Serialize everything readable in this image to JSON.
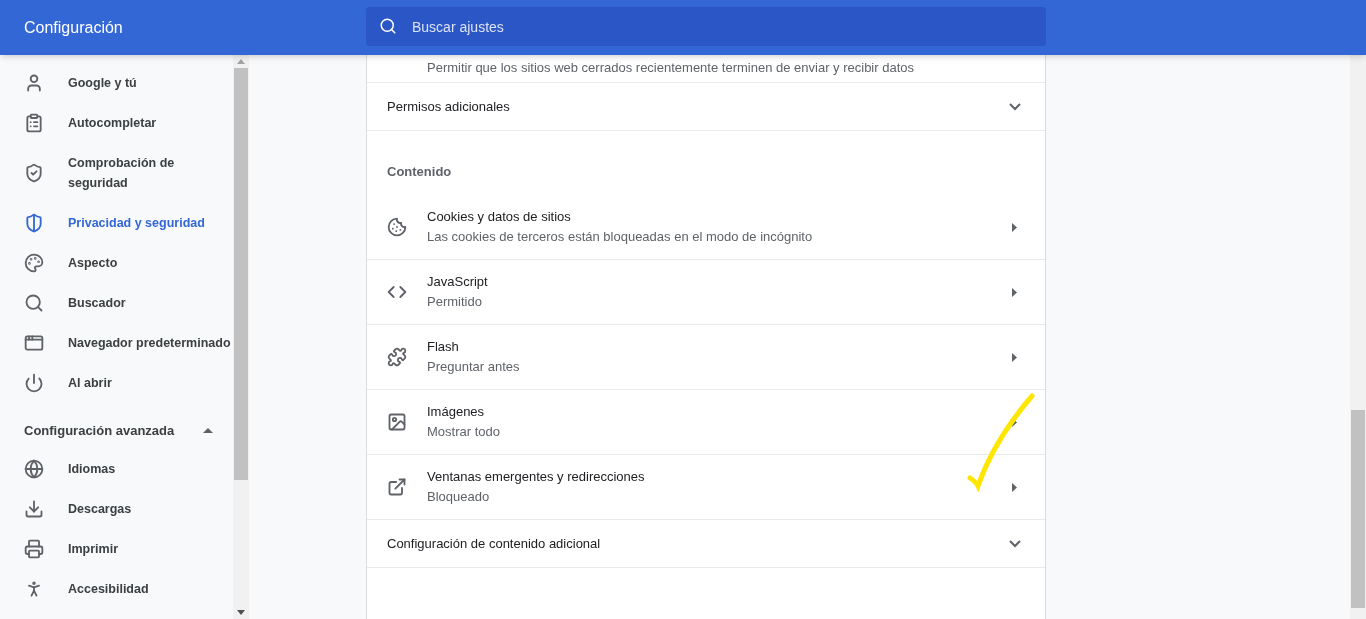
{
  "header": {
    "title": "Configuración",
    "search": {
      "placeholder": "Buscar ajustes"
    }
  },
  "sidebar": {
    "items": [
      {
        "label": "Google y tú",
        "selected": false
      },
      {
        "label": "Autocompletar",
        "selected": false
      },
      {
        "label": "Comprobación de seguridad",
        "selected": false
      },
      {
        "label": "Privacidad y seguridad",
        "selected": true
      },
      {
        "label": "Aspecto",
        "selected": false
      },
      {
        "label": "Buscador",
        "selected": false
      },
      {
        "label": "Navegador predeterminado",
        "selected": false
      },
      {
        "label": "Al abrir",
        "selected": false
      }
    ],
    "advanced": {
      "label": "Configuración avanzada",
      "expanded": true,
      "items": [
        {
          "label": "Idiomas",
          "selected": false
        },
        {
          "label": "Descargas",
          "selected": false
        },
        {
          "label": "Imprimir",
          "selected": false
        },
        {
          "label": "Accesibilidad",
          "selected": false
        }
      ]
    }
  },
  "content": {
    "rows": [
      {
        "kind": "note",
        "label": "Permitir que los sitios web cerrados recientemente terminen de enviar y recibir datos"
      },
      {
        "kind": "expand",
        "label": "Permisos adicionales",
        "expanded": false
      },
      {
        "kind": "section",
        "label": "Contenido"
      },
      {
        "kind": "link",
        "label": "Cookies y datos de sitios",
        "sublabel": "Las cookies de terceros están bloqueadas en el modo de incógnito"
      },
      {
        "kind": "link",
        "label": "JavaScript",
        "sublabel": "Permitido"
      },
      {
        "kind": "link",
        "label": "Flash",
        "sublabel": "Preguntar antes"
      },
      {
        "kind": "link",
        "label": "Imágenes",
        "sublabel": "Mostrar todo"
      },
      {
        "kind": "link",
        "label": "Ventanas emergentes y redirecciones",
        "sublabel": "Bloqueado"
      },
      {
        "kind": "expand",
        "label": "Configuración de contenido adicional",
        "expanded": false
      }
    ]
  }
}
